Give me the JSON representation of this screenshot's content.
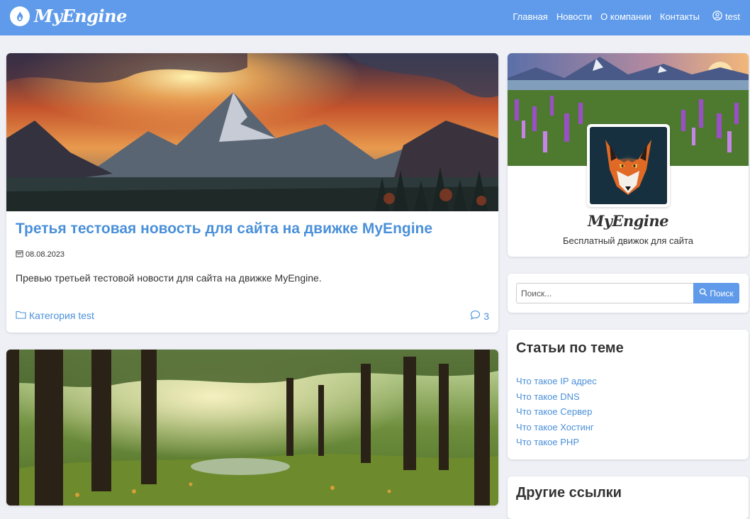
{
  "brand": {
    "name": "MyEngine",
    "logo_icon": "flame-icon"
  },
  "nav": {
    "links": [
      "Главная",
      "Новости",
      "О компании",
      "Контакты"
    ],
    "user": {
      "icon": "user-circle-icon",
      "name": "test"
    }
  },
  "news": [
    {
      "title": "Третья тестовая новость для сайта на движке MyEngine",
      "date": "08.08.2023",
      "preview": "Превью третьей тестовой новости для сайта на движке MyEngine.",
      "category": "Категория test",
      "comments": "3"
    },
    {}
  ],
  "profile": {
    "name": "MyEngine",
    "description": "Бесплатный движок для сайта"
  },
  "search": {
    "placeholder": "Поиск...",
    "button": "Поиск"
  },
  "articles": {
    "title": "Статьи по теме",
    "items": [
      "Что такое IP адрес",
      "Что такое DNS",
      "Что такое Сервер",
      "Что такое Хостинг",
      "Что такое PHP"
    ]
  },
  "other_links": {
    "title": "Другие ссылки"
  },
  "colors": {
    "accent": "#5f9bea",
    "link": "#4a90d9",
    "background": "#eef0f6"
  }
}
